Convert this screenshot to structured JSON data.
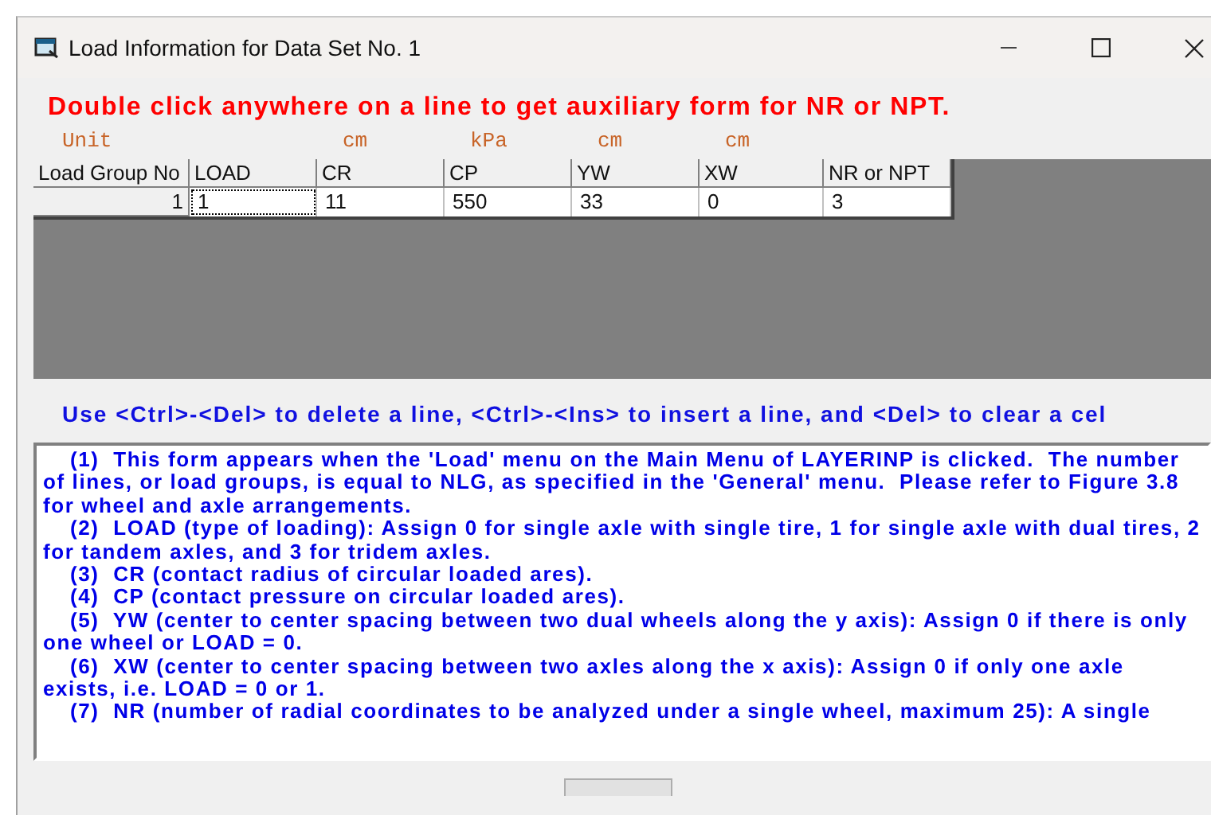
{
  "window": {
    "title": "Load Information for Data Set No. 1"
  },
  "instruction": "Double click anywhere on a line to get auxiliary form for NR or NPT.",
  "unit_label": "Unit",
  "table": {
    "columns": [
      {
        "label": "Load Group No"
      },
      {
        "label": "LOAD"
      },
      {
        "label": "CR",
        "unit": "cm"
      },
      {
        "label": "CP",
        "unit": "kPa"
      },
      {
        "label": "YW",
        "unit": "cm"
      },
      {
        "label": "XW",
        "unit": "cm"
      },
      {
        "label": "NR or NPT"
      }
    ],
    "rows": [
      {
        "cells": [
          {
            "text": "1",
            "kind": "header",
            "focused": false
          },
          {
            "text": "1",
            "kind": "data",
            "focused": true
          },
          {
            "text": "11",
            "kind": "data",
            "focused": false
          },
          {
            "text": "550",
            "kind": "data",
            "focused": false
          },
          {
            "text": "33",
            "kind": "data",
            "focused": false
          },
          {
            "text": "0",
            "kind": "data",
            "focused": false
          },
          {
            "text": "3",
            "kind": "data",
            "focused": false
          }
        ]
      }
    ]
  },
  "hint": "Use <Ctrl>-<Del> to delete a line, <Ctrl>-<Ins> to insert a line, and <Del> to clear a  cel",
  "help": [
    {
      "lines": [
        "(1)  This form appears when the 'Load' menu on the Main Menu of LAYERINP is clicked.  The number",
        "of lines, or load groups, is equal to NLG, as specified in the 'General' menu.  Please refer to Figure 3.8",
        "for wheel and axle arrangements."
      ]
    },
    {
      "lines": [
        "(2)  LOAD (type of loading): Assign 0 for single axle with single tire, 1 for single axle with dual tires, 2",
        "for tandem axles, and 3 for tridem axles."
      ]
    },
    {
      "lines": [
        "(3)  CR (contact radius of circular loaded ares)."
      ]
    },
    {
      "lines": [
        "(4)  CP (contact pressure on circular loaded ares)."
      ]
    },
    {
      "lines": [
        "(5)  YW (center to center spacing between two dual wheels along the y axis): Assign 0 if there is only",
        "one wheel or LOAD = 0."
      ]
    },
    {
      "lines": [
        "(6)  XW (center to center spacing between two axles along the x axis): Assign 0 if only one axle",
        "exists, i.e. LOAD = 0 or 1."
      ]
    },
    {
      "lines": [
        "(7)  NR (number of radial coordinates to be analyzed under a single wheel, maximum 25): A single"
      ]
    }
  ]
}
